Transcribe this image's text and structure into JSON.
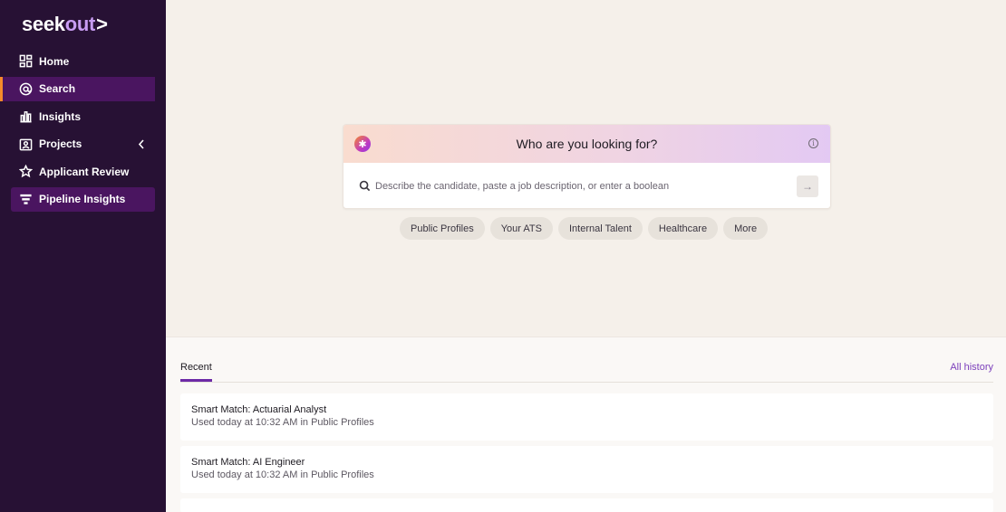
{
  "app": {
    "logo_main": "seek",
    "logo_accent": "out",
    "logo_chevron": ">"
  },
  "sidebar": {
    "items": [
      {
        "label": "Home",
        "icon": "home-grid-icon"
      },
      {
        "label": "Search",
        "icon": "search-at-icon",
        "active": true
      },
      {
        "label": "Insights",
        "icon": "insights-chart-icon"
      },
      {
        "label": "Projects",
        "icon": "projects-icon"
      },
      {
        "label": "Applicant Review",
        "icon": "star-icon"
      },
      {
        "label": "Pipeline Insights",
        "icon": "filter-icon"
      }
    ],
    "accent_color": "#f58a2b",
    "background": "#271134",
    "active_background": "#4a1560"
  },
  "search_card": {
    "title": "Who are you looking for?",
    "placeholder": "Describe the candidate, paste a job description, or enter a boolean",
    "info_glyph": "i",
    "submit_glyph": "→"
  },
  "chips": [
    "Public Profiles",
    "Your ATS",
    "Internal Talent",
    "Healthcare",
    "More"
  ],
  "recent": {
    "tab_label": "Recent",
    "all_history_label": "All history",
    "items": [
      {
        "title": "Smart Match: Actuarial Analyst",
        "subtitle": "Used today at 10:32 AM in Public Profiles"
      },
      {
        "title": "Smart Match: AI Engineer",
        "subtitle": "Used today at 10:32 AM in Public Profiles"
      }
    ]
  }
}
